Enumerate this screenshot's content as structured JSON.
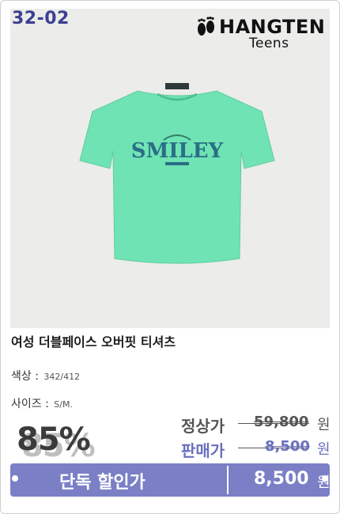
{
  "product_code": "32-02",
  "brand": {
    "name": "HANGTEN",
    "sub": "Teens"
  },
  "product": {
    "title": "여성 더블페이스 오버핏 티셔츠",
    "shirt_print": "SMILEY",
    "shirt_color": "#6fe3b4"
  },
  "specs": {
    "color_label": "색상 : ",
    "color_value": "342/412",
    "size_label": "사이즈 : ",
    "size_value": "S/M."
  },
  "pricing": {
    "discount": "85%",
    "regular_label": "정상가",
    "regular_price": "59,800",
    "sale_label": "판매가",
    "sale_price": "8,500",
    "currency": "원"
  },
  "cta": {
    "label": "단독 할인가",
    "price": "8,500",
    "currency": "원"
  },
  "colors": {
    "accent": "#7a7fc6",
    "code": "#3d3f93"
  }
}
